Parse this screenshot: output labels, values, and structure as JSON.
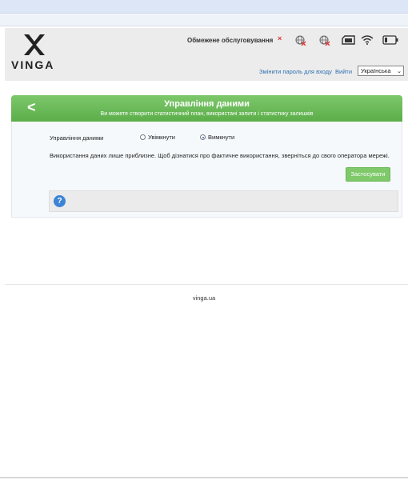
{
  "header": {
    "logo_text": "VINGA",
    "service_status": "Обмежене обслуговування",
    "status_x": "×",
    "change_password_link": "Змінити пароль для входу",
    "exit_link": "Вийти",
    "language_selected": "Українська",
    "icons": [
      "globe-blocked-icon",
      "globe-blocked-icon",
      "sim-card-icon",
      "wifi-icon",
      "battery-icon"
    ]
  },
  "panel": {
    "back_symbol": "<",
    "title": "Управління даними",
    "subtitle": "Ви можете створити статистичний план, використані запити і статистику залишків"
  },
  "data_management": {
    "label": "Управління даними",
    "option_on": "Увімкнути",
    "option_off": "Вимкнути",
    "selected": "Вимкнути"
  },
  "note": "Використання даних лише приблизне. Щоб дізнатися про фактичне використання, зверніться до свого оператора мережі.",
  "apply_button": "Застосувати",
  "help_symbol": "?",
  "footer": {
    "site": "vinga.ua"
  },
  "colors": {
    "accent_green": "#6cbb58",
    "link_blue": "#3070b0",
    "error_red": "#e03030",
    "help_blue": "#3d83d6"
  }
}
